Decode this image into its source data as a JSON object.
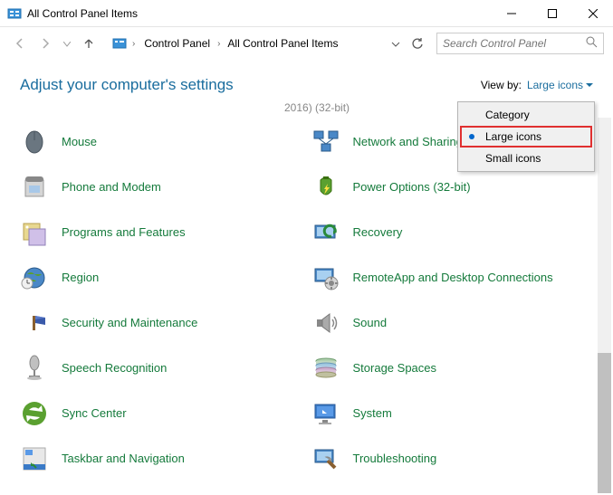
{
  "titlebar": {
    "text": "All Control Panel Items"
  },
  "breadcrumb": {
    "item1": "Control Panel",
    "item2": "All Control Panel Items"
  },
  "search": {
    "placeholder": "Search Control Panel"
  },
  "header": {
    "title": "Adjust your computer's settings",
    "view_by_label": "View by:",
    "view_by_value": "Large icons"
  },
  "truncated": "2016) (32-bit)",
  "dropdown": {
    "opt1": "Category",
    "opt2": "Large icons",
    "opt3": "Small icons"
  },
  "items": [
    {
      "label": "Mouse",
      "icon": "mouse-icon"
    },
    {
      "label": "Network and Sharing Center",
      "icon": "network-icon"
    },
    {
      "label": "Phone and Modem",
      "icon": "phone-icon"
    },
    {
      "label": "Power Options (32-bit)",
      "icon": "power-icon"
    },
    {
      "label": "Programs and Features",
      "icon": "programs-icon"
    },
    {
      "label": "Recovery",
      "icon": "recovery-icon"
    },
    {
      "label": "Region",
      "icon": "region-icon"
    },
    {
      "label": "RemoteApp and Desktop Connections",
      "icon": "remoteapp-icon"
    },
    {
      "label": "Security and Maintenance",
      "icon": "security-icon"
    },
    {
      "label": "Sound",
      "icon": "sound-icon"
    },
    {
      "label": "Speech Recognition",
      "icon": "speech-icon"
    },
    {
      "label": "Storage Spaces",
      "icon": "storage-icon"
    },
    {
      "label": "Sync Center",
      "icon": "sync-icon"
    },
    {
      "label": "System",
      "icon": "system-icon"
    },
    {
      "label": "Taskbar and Navigation",
      "icon": "taskbar-icon"
    },
    {
      "label": "Troubleshooting",
      "icon": "troubleshoot-icon"
    }
  ]
}
